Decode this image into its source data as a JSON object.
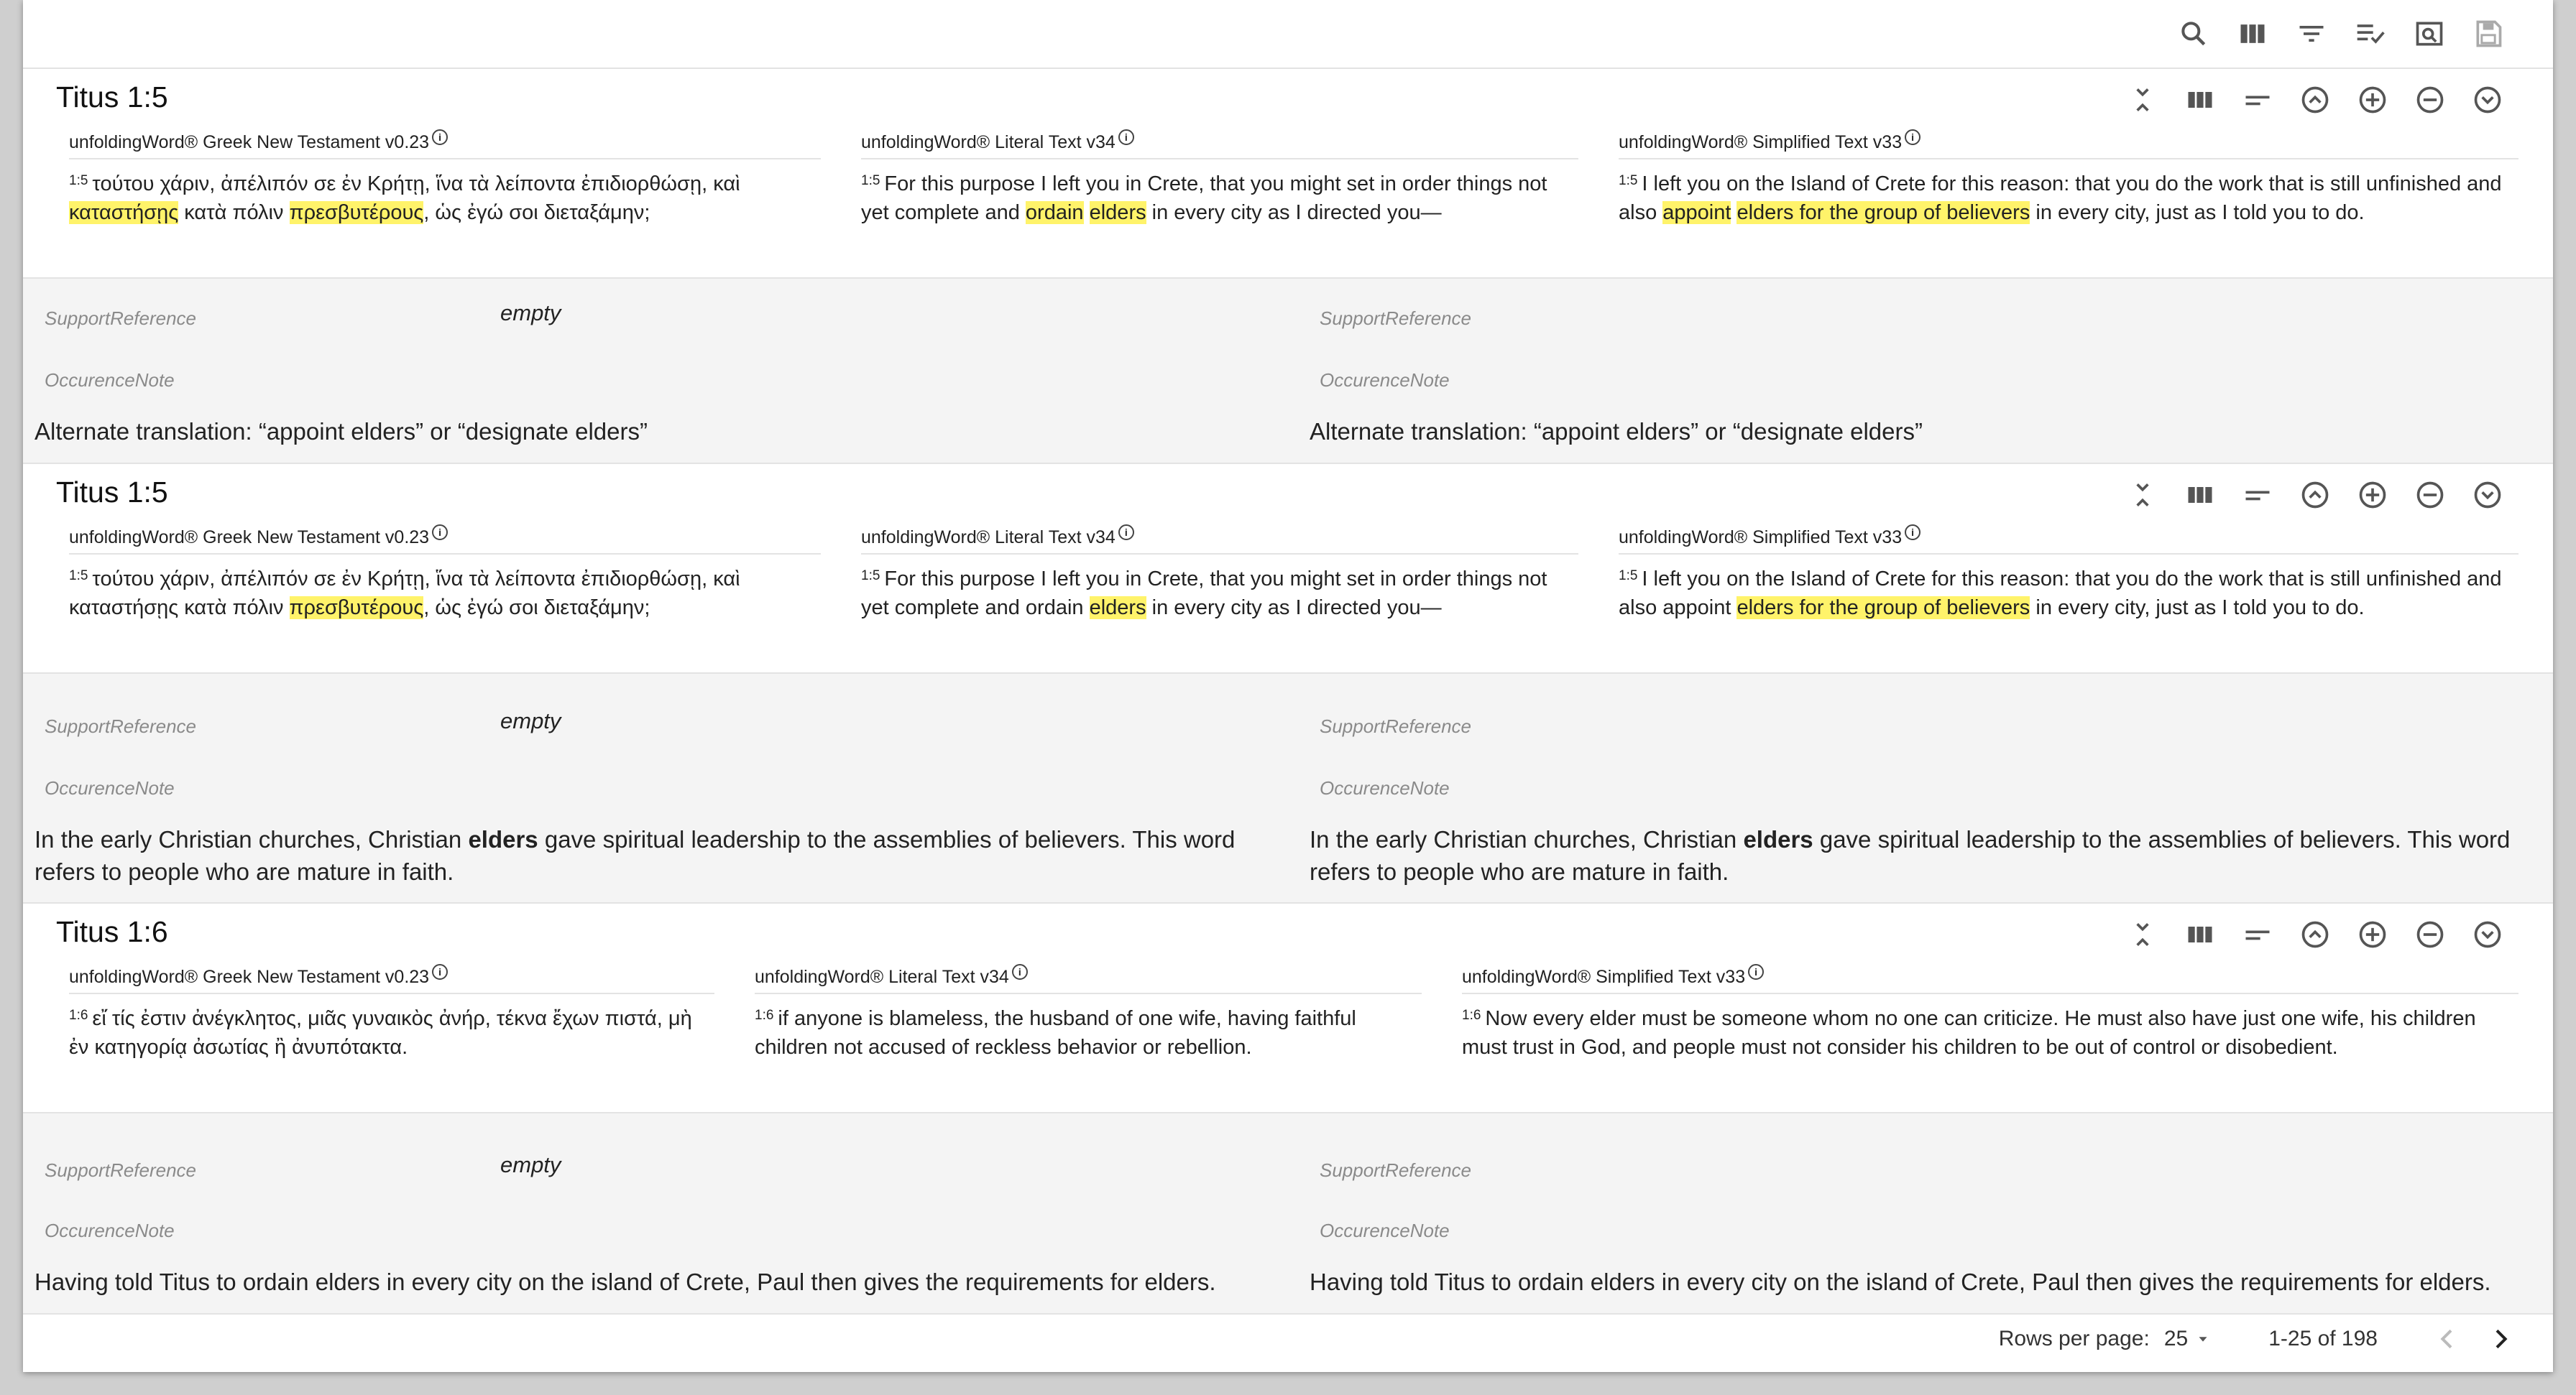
{
  "toolbar": {
    "icons": [
      "search-icon",
      "view-columns-icon",
      "filter-icon",
      "checklist-icon",
      "preview-icon",
      "save-icon"
    ]
  },
  "rows": [
    {
      "title": "Titus 1:5",
      "columns": [
        {
          "title": "unfoldingWord® Greek New Testament v0.23",
          "ref": "1:5"
        },
        {
          "title": "unfoldingWord® Literal Text v34",
          "ref": "1:5"
        },
        {
          "title": "unfoldingWord® Simplified Text v33",
          "ref": "1:5"
        }
      ],
      "left": {
        "support_label": "SupportReference",
        "empty_label": "empty",
        "occurrence_label": "OccurenceNote",
        "note": "Alternate translation: “appoint elders” or “designate elders”"
      },
      "right": {
        "support_label": "SupportReference",
        "occurrence_label": "OccurenceNote",
        "note": "Alternate translation: “appoint elders” or “designate elders”"
      }
    },
    {
      "title": "Titus 1:5",
      "columns": [
        {
          "title": "unfoldingWord® Greek New Testament v0.23",
          "ref": "1:5"
        },
        {
          "title": "unfoldingWord® Literal Text v34",
          "ref": "1:5"
        },
        {
          "title": "unfoldingWord® Simplified Text v33",
          "ref": "1:5"
        }
      ],
      "left": {
        "support_label": "SupportReference",
        "empty_label": "empty",
        "occurrence_label": "OccurenceNote"
      },
      "right": {
        "support_label": "SupportReference",
        "occurrence_label": "OccurenceNote"
      }
    },
    {
      "title": "Titus 1:6",
      "columns": [
        {
          "title": "unfoldingWord® Greek New Testament v0.23",
          "ref": "1:6"
        },
        {
          "title": "unfoldingWord® Literal Text v34",
          "ref": "1:6"
        },
        {
          "title": "unfoldingWord® Simplified Text v33",
          "ref": "1:6"
        }
      ],
      "left": {
        "support_label": "SupportReference",
        "empty_label": "empty",
        "occurrence_label": "OccurenceNote",
        "note": "Having told Titus to ordain elders in every city on the island of Crete, Paul then gives the requirements for elders."
      },
      "right": {
        "support_label": "SupportReference",
        "occurrence_label": "OccurenceNote",
        "note": "Having told Titus to ordain elders in every city on the island of Crete, Paul then gives the requirements for elders."
      }
    }
  ],
  "verses": {
    "r1_greek": [
      {
        "t": "τούτου χάριν, ἀπέλιπόν σε ἐν Κρήτῃ, ἵνα τὰ λείποντα ἐπιδιορθώσῃ, καὶ "
      },
      {
        "t": "καταστήσῃς",
        "h": true
      },
      {
        "t": " κατὰ πόλιν "
      },
      {
        "t": "πρεσβυτέρους",
        "h": true
      },
      {
        "t": ", ὡς ἐγώ σοι διεταξάμην;"
      }
    ],
    "r1_ult": [
      {
        "t": "For this purpose I left you in Crete, that you might set in order things not yet complete and "
      },
      {
        "t": "ordain",
        "h": true
      },
      {
        "t": " "
      },
      {
        "t": "elders",
        "h": true
      },
      {
        "t": " in every city as I directed you—"
      }
    ],
    "r1_ust": [
      {
        "t": "I left you on the Island of Crete for this reason: that you do the work that is still unfinished and also "
      },
      {
        "t": "appoint",
        "h": true
      },
      {
        "t": " "
      },
      {
        "t": "elders for the group of believers",
        "h": true
      },
      {
        "t": " in every city, just as I told you to do."
      }
    ],
    "r2_greek": [
      {
        "t": "τούτου χάριν, ἀπέλιπόν σε ἐν Κρήτῃ, ἵνα τὰ λείποντα ἐπιδιορθώσῃ, καὶ καταστήσῃς κατὰ πόλιν "
      },
      {
        "t": "πρεσβυτέρους",
        "h": true
      },
      {
        "t": ", ὡς ἐγώ σοι διεταξάμην;"
      }
    ],
    "r2_ult": [
      {
        "t": "For this purpose I left you in Crete, that you might set in order things not yet complete and ordain "
      },
      {
        "t": "elders",
        "h": true
      },
      {
        "t": " in every city as I directed you—"
      }
    ],
    "r2_ust": [
      {
        "t": "I left you on the Island of Crete for this reason: that you do the work that is still unfinished and also appoint "
      },
      {
        "t": "elders for the group of believers",
        "h": true
      },
      {
        "t": " in every city, just as I told you to do."
      }
    ],
    "r3_greek": [
      {
        "t": "εἴ τίς ἐστιν ἀνέγκλητος, μιᾶς γυναικὸς ἀνήρ, τέκνα ἔχων πιστά, μὴ ἐν κατηγορίᾳ ἀσωτίας ἢ ἀνυπότακτα."
      }
    ],
    "r3_ult": [
      {
        "t": "if anyone is blameless, the husband of one wife, having faithful children not accused of reckless behavior or rebellion."
      }
    ],
    "r3_ust": [
      {
        "t": "Now every elder must be someone whom no one can criticize. He must also have just one wife, his children must trust in God, and people must not consider his children to be out of control or disobedient."
      }
    ]
  },
  "notes": {
    "r2_left": [
      {
        "t": "In the early Christian churches, Christian "
      },
      {
        "t": "elders",
        "b": true
      },
      {
        "t": " gave spiritual leadership to the assemblies of believers. This word refers to people who are mature in faith."
      }
    ],
    "r2_right": [
      {
        "t": "In the early Christian churches, Christian "
      },
      {
        "t": "elders",
        "b": true
      },
      {
        "t": " gave spiritual leadership to the assemblies of believers. This word refers to people who are mature in faith."
      }
    ]
  },
  "pagination": {
    "rows_per_page_label": "Rows per page:",
    "rows_per_page_value": "25",
    "range_text": "1-25 of 198"
  },
  "colors": {
    "highlight": "#fff36a",
    "detail_bg": "#f4f4f4"
  }
}
